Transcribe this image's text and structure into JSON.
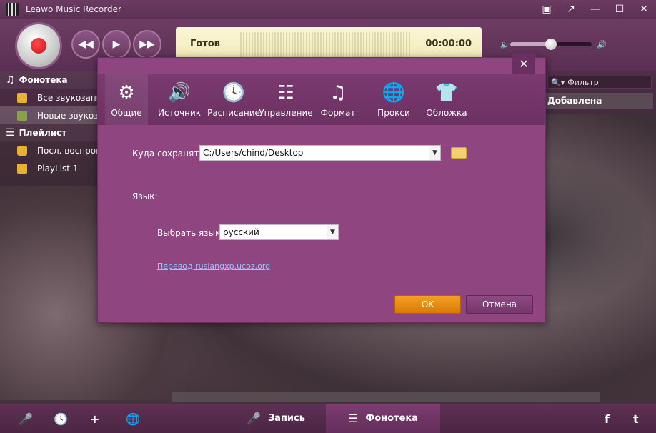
{
  "window": {
    "title": "Leawo Music Recorder",
    "controls": [
      "▣",
      "↗",
      "—",
      "☐",
      "✕"
    ]
  },
  "player": {
    "status": "Готов",
    "time": "00:00:00",
    "volume_fraction": 0.5
  },
  "sidebar": {
    "library_header": "Фонотека",
    "library_items": [
      {
        "label": "Все звукозаписи",
        "selected": false
      },
      {
        "label": "Новые звукозаписи",
        "selected": true
      }
    ],
    "playlist_header": "Плейлист",
    "playlist_items": [
      {
        "label": "Посл. воспроизведенные",
        "selected": false
      },
      {
        "label": "PlayList 1",
        "selected": false
      }
    ]
  },
  "list": {
    "filter_placeholder": "Фильтр",
    "column_added": "Добавлена"
  },
  "modal": {
    "close_label": "✕",
    "tabs": [
      {
        "id": "general",
        "label": "Общие",
        "glyph": "⚙",
        "active": true
      },
      {
        "id": "source",
        "label": "Источник",
        "glyph": "🔊",
        "active": false
      },
      {
        "id": "schedule",
        "label": "Расписание",
        "glyph": "🕓",
        "active": false
      },
      {
        "id": "control",
        "label": "Управление",
        "glyph": "☷",
        "active": false
      },
      {
        "id": "format",
        "label": "Формат",
        "glyph": "♫",
        "active": false
      },
      {
        "id": "proxy",
        "label": "Прокси",
        "glyph": "🌐",
        "active": false
      },
      {
        "id": "skin",
        "label": "Обложка",
        "glyph": "👕",
        "active": false
      }
    ],
    "save_to_label": "Куда сохранять:",
    "save_to_value": "C:/Users/chind/Desktop",
    "language_section": "Язык:",
    "choose_language_label": "Выбрать язык:",
    "language_value": "русский",
    "translation_link": "Перевод ruslangxp.ucoz.org",
    "ok_label": "OK",
    "cancel_label": "Отмена"
  },
  "bottombar": {
    "record_tab": "Запись",
    "library_tab": "Фонотека",
    "facebook": "f",
    "twitter": "t"
  },
  "colors": {
    "accent": "#8e4580",
    "ok_button": "#e88a12",
    "display": "#f5efc4"
  }
}
